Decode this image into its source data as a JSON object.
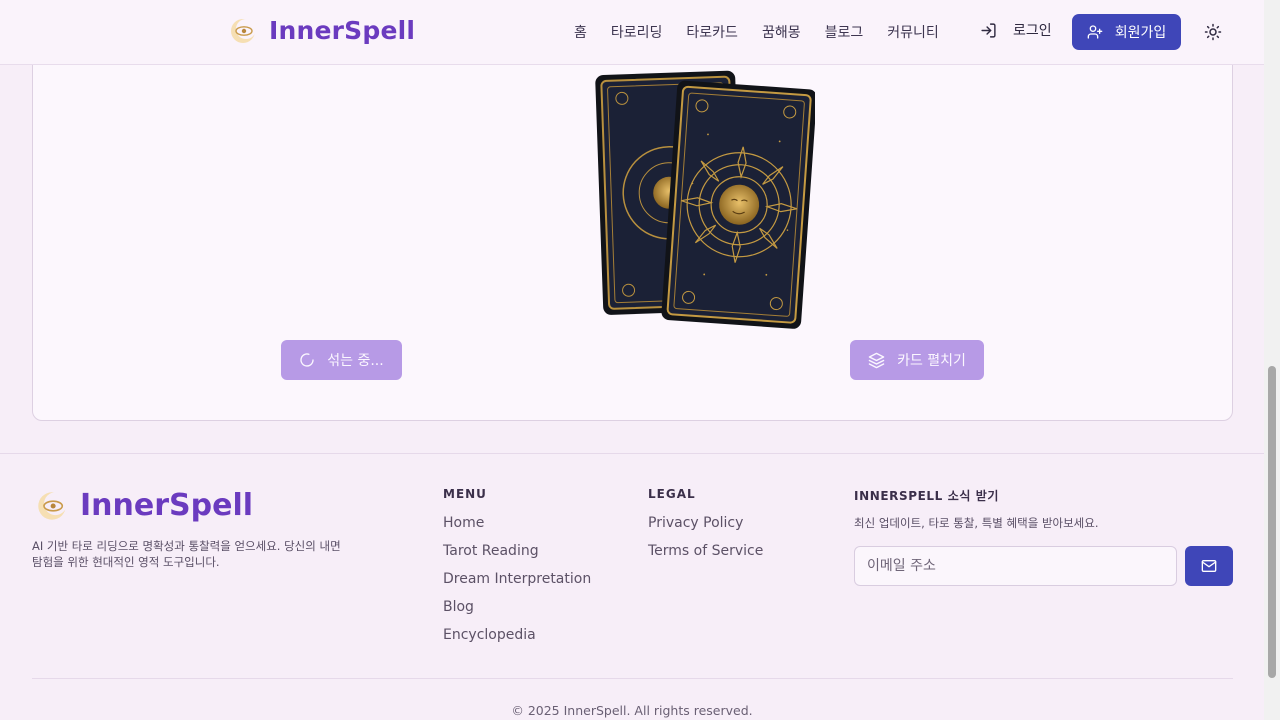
{
  "header": {
    "brand": "InnerSpell",
    "nav": [
      "홈",
      "타로리딩",
      "타로카드",
      "꿈해몽",
      "블로그",
      "커뮤니티"
    ],
    "login_label": "로그인",
    "signup_label": "회원가입",
    "icons": {
      "logo": "eye-moon-logo",
      "login": "log-in-icon",
      "signup": "user-plus-icon",
      "theme": "sun-icon"
    }
  },
  "main": {
    "shuffle_label": "섞는 중...",
    "spread_label": "카드 펼치기",
    "icons": {
      "shuffle": "loader-icon",
      "spread": "layers-icon"
    },
    "deck_image": "tarot-card-backs-sun"
  },
  "footer": {
    "brand": "InnerSpell",
    "description": "AI 기반 타로 리딩으로 명확성과 통찰력을 얻으세요. 당신의 내면 탐험을 위한 현대적인 영적 도구입니다.",
    "menu": {
      "title": "MENU",
      "items": [
        "Home",
        "Tarot Reading",
        "Dream Interpretation",
        "Blog",
        "Encyclopedia"
      ]
    },
    "legal": {
      "title": "LEGAL",
      "items": [
        "Privacy Policy",
        "Terms of Service"
      ]
    },
    "newsletter": {
      "title": "INNERSPELL 소식 받기",
      "description": "최신 업데이트, 타로 통찰, 특별 혜택을 받아보세요.",
      "email_placeholder": "이메일 주소",
      "send_icon": "mail-icon"
    },
    "copyright": "© 2025 InnerSpell. All rights reserved."
  },
  "colors": {
    "brand": "#6b3bbf",
    "primary": "#3f46b8",
    "button_disabled": "#b79ae6",
    "background": "#f7eef8"
  }
}
